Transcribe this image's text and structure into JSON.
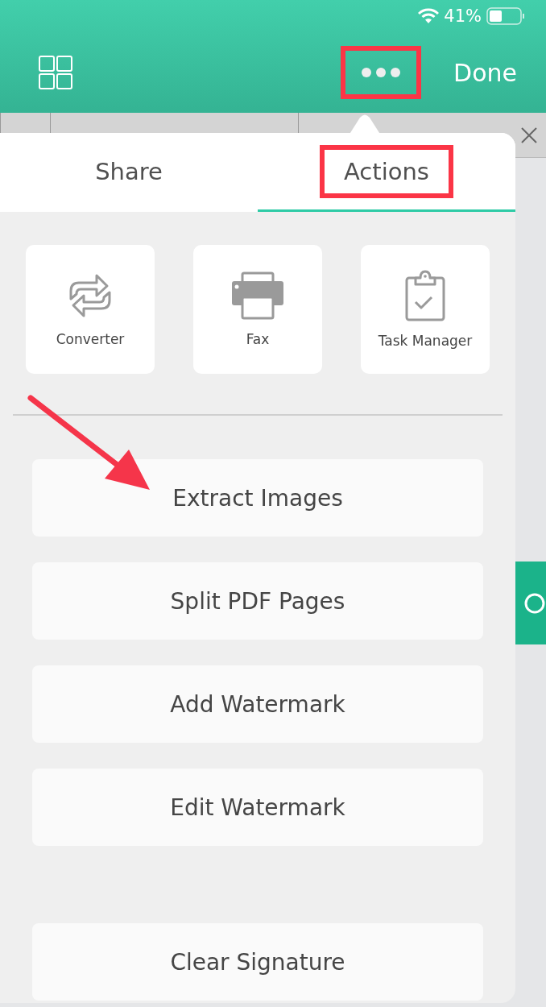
{
  "status_bar": {
    "battery_percent": "41%"
  },
  "toolbar": {
    "done_label": "Done"
  },
  "popover": {
    "tabs": [
      {
        "label": "Share",
        "selected": false
      },
      {
        "label": "Actions",
        "selected": true
      }
    ],
    "tools": [
      {
        "label": "Converter",
        "kind": "converter"
      },
      {
        "label": "Fax",
        "kind": "fax"
      },
      {
        "label": "Task Manager",
        "kind": "task"
      }
    ],
    "actions": [
      "Extract Images",
      "Split PDF Pages",
      "Add Watermark",
      "Edit Watermark"
    ],
    "bottom_action": "Clear Signature"
  }
}
